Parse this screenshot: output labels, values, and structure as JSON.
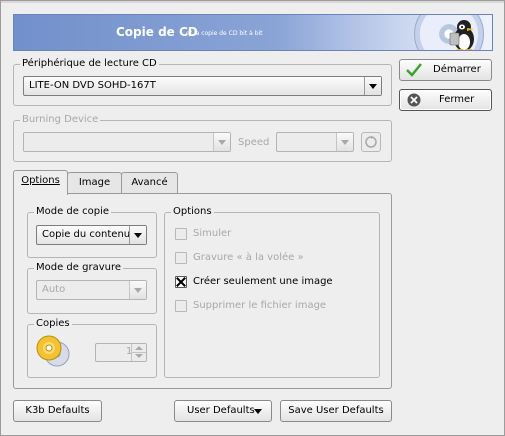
{
  "banner": {
    "title": "Copie de CD",
    "subtitle": "et la copie de CD bit à bit"
  },
  "reader": {
    "group_title": "Périphérique de lecture CD",
    "selected": "LITE-ON DVD SOHD-167T"
  },
  "burning": {
    "group_title": "Burning Device",
    "selected": "",
    "speed_label": "Speed",
    "speed_value": ""
  },
  "actions": {
    "start": "Démarrer",
    "close": "Fermer"
  },
  "tabs": [
    {
      "label": "Options",
      "active": true
    },
    {
      "label": "Image",
      "active": false
    },
    {
      "label": "Avancé",
      "active": false
    }
  ],
  "copy_mode": {
    "group_title": "Mode de copie",
    "selected": "Copie du contenu"
  },
  "write_mode": {
    "group_title": "Mode de gravure",
    "selected": "Auto"
  },
  "copies": {
    "group_title": "Copies",
    "value": "1"
  },
  "options": {
    "group_title": "Options",
    "items": [
      {
        "label": "Simuler",
        "checked": false,
        "enabled": false
      },
      {
        "label": "Gravure « à la volée »",
        "checked": false,
        "enabled": false
      },
      {
        "label": "Créer seulement une image",
        "checked": true,
        "enabled": true
      },
      {
        "label": "Supprimer le fichier image",
        "checked": false,
        "enabled": false
      }
    ]
  },
  "footer": {
    "k3b_defaults": "K3b Defaults",
    "user_defaults": "User Defaults",
    "save_user_defaults": "Save User Defaults"
  },
  "colors": {
    "banner": "#7290cc",
    "start_check": "#3aa52b",
    "close_icon": "#555555"
  }
}
